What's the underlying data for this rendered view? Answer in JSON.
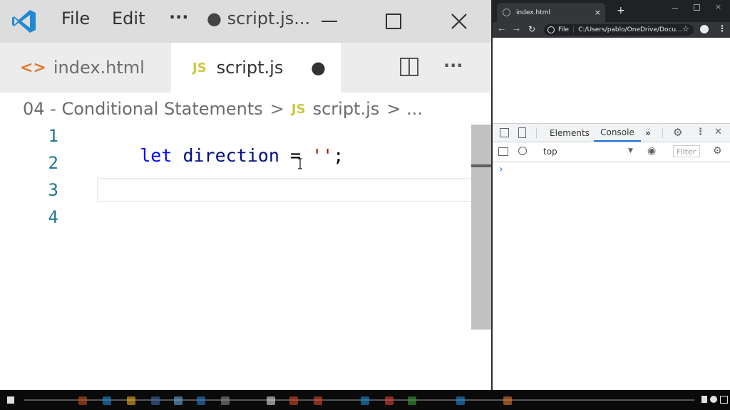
{
  "vscode": {
    "menu": {
      "file": "File",
      "edit": "Edit",
      "more": "···"
    },
    "window_title": "● script.js...",
    "tabs": [
      {
        "label": "index.html",
        "icon": "html-code-icon"
      },
      {
        "label": "script.js",
        "icon": "js-icon",
        "dirty": "●"
      }
    ],
    "breadcrumb": {
      "folder": "04 - Conditional Statements",
      "sep": ">",
      "js_badge": "JS",
      "file": "script.js",
      "tail": "> ..."
    },
    "lines": [
      "1",
      "2",
      "3",
      "4"
    ],
    "code": {
      "kw": "let",
      "var": "direction",
      "op": "=",
      "str": "''",
      "end": ";"
    },
    "js_badge": "JS",
    "more": "···"
  },
  "chrome": {
    "tab_title": "index.html",
    "new_tab": "+",
    "close": "×",
    "file_label": "File",
    "url": "C:/Users/pablo/OneDrive/Docu...",
    "devtools": {
      "tabs": {
        "elements": "Elements",
        "console": "Console",
        "more": "»"
      },
      "context": "top",
      "filter_placeholder": "Filter",
      "prompt": "›"
    }
  },
  "colors": {
    "accent_blue": "#007acc",
    "js_yellow": "#cbcb41",
    "keyword": "#0000ff",
    "variable": "#001080",
    "string": "#a31515",
    "line_number": "#237893"
  }
}
